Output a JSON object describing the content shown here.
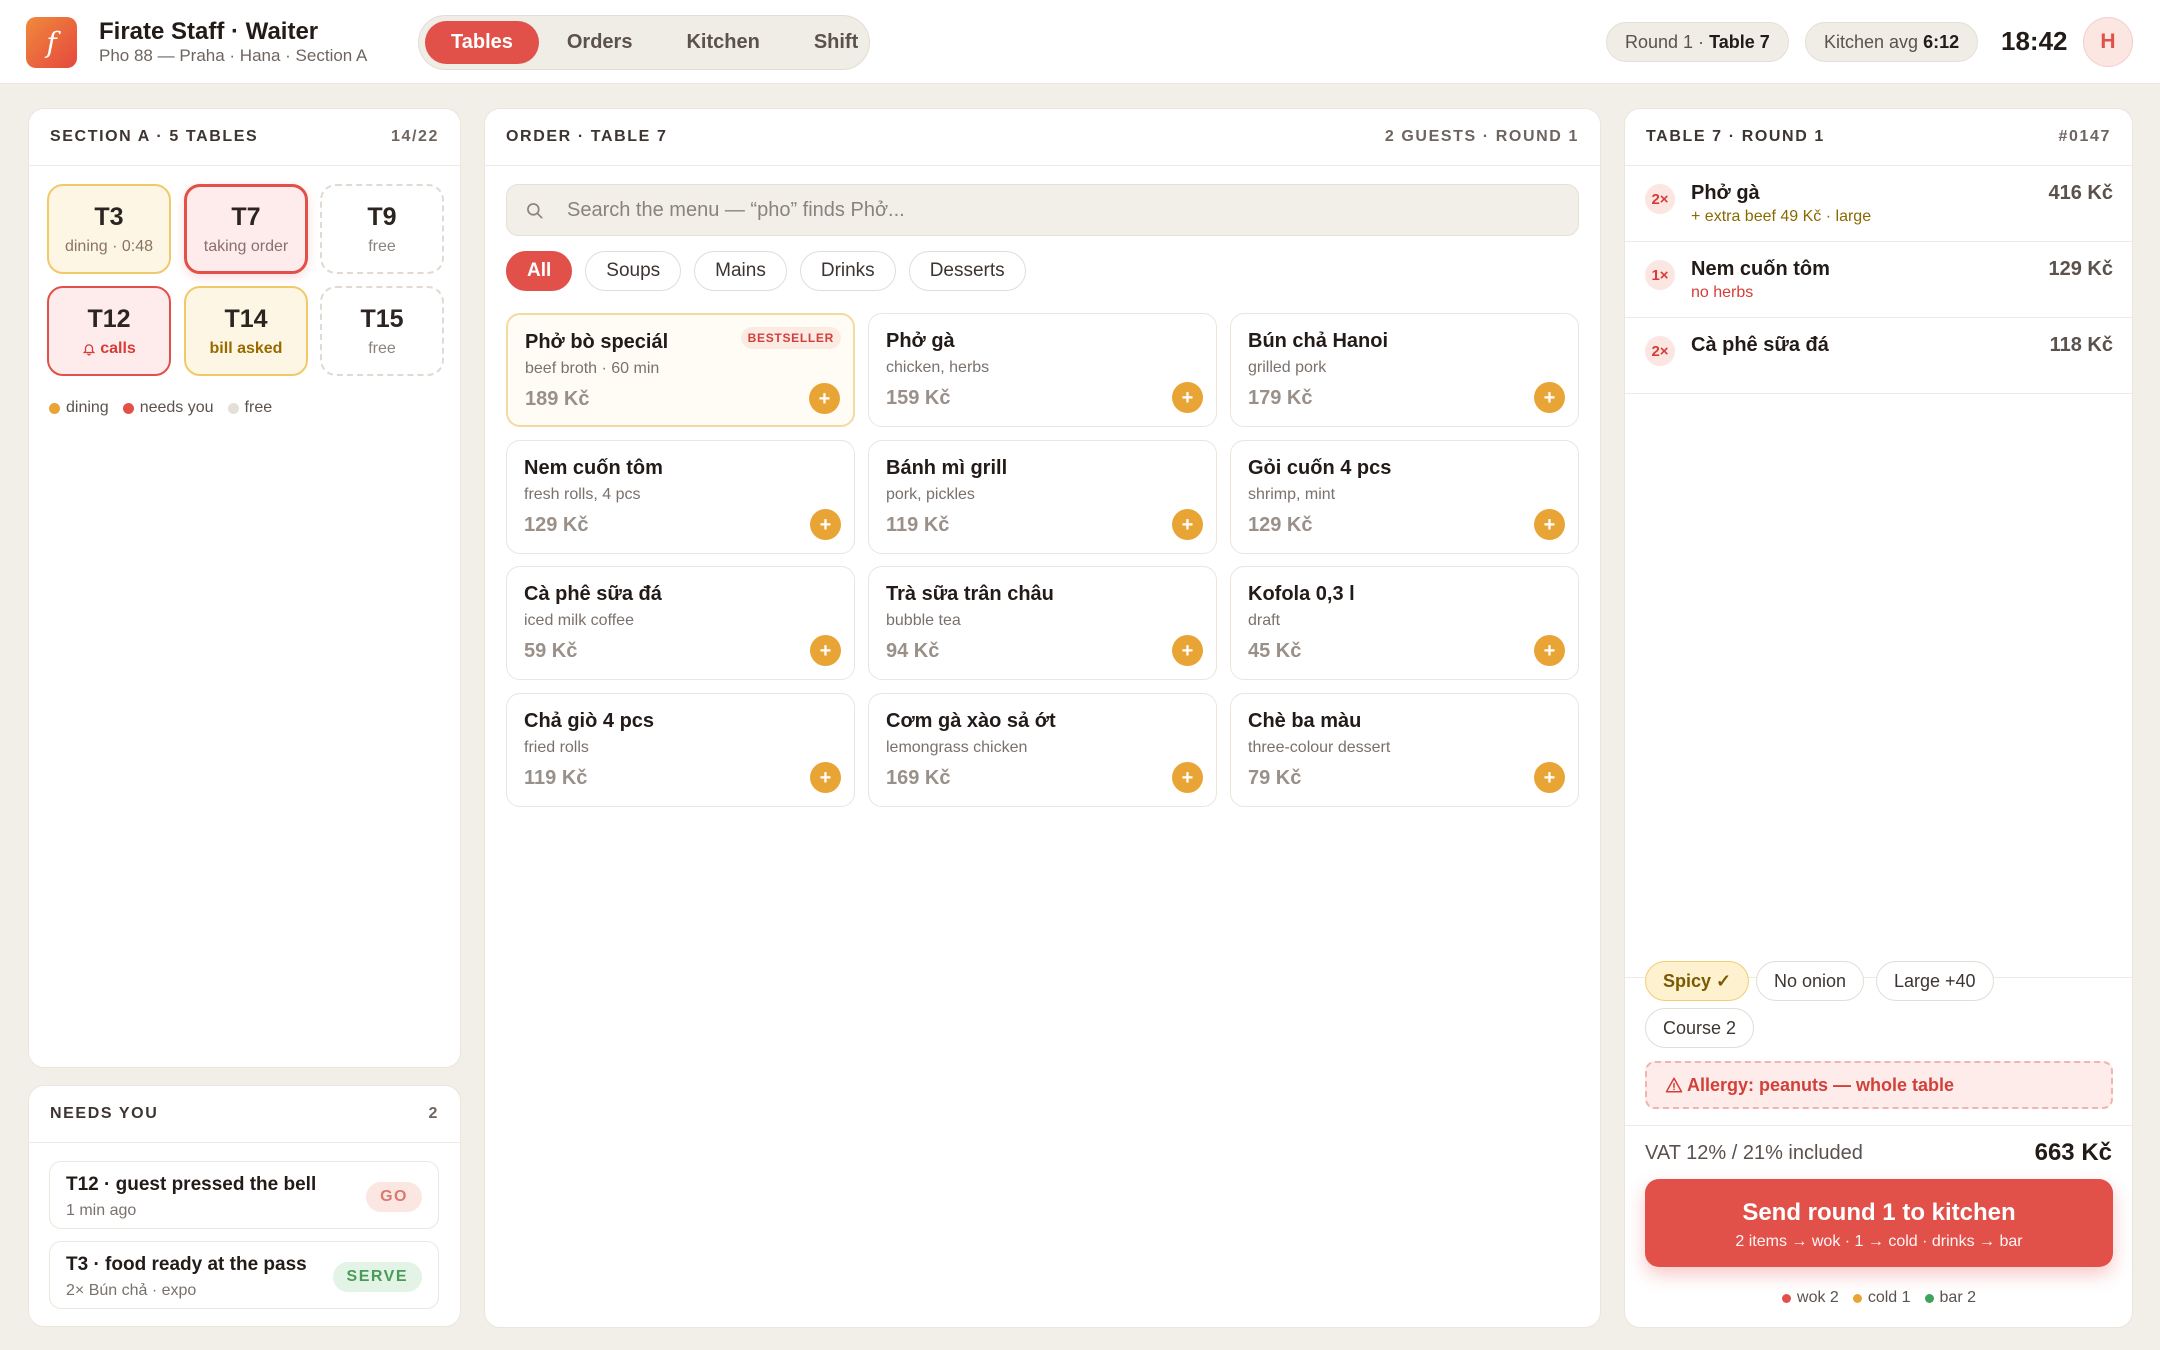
{
  "app": {
    "logo_letter": "f",
    "title": "Firate Staff · Waiter",
    "subtitle": "Pho 88 — Praha · Hana · Section A"
  },
  "nav": {
    "tabs": [
      {
        "label": "Tables",
        "active": true
      },
      {
        "label": "Orders"
      },
      {
        "label": "Kitchen"
      },
      {
        "label": "Shift"
      }
    ]
  },
  "header": {
    "round_prefix": "Round 1 ·",
    "round_table": "Table 7",
    "kitchen_prefix": "Kitchen avg",
    "kitchen_value": "6:12",
    "clock": "18:42",
    "avatar": "H"
  },
  "section": {
    "title": "SECTION A · 5 TABLES",
    "count": "14/22",
    "tables": [
      {
        "name": "T3",
        "status": "dining · 0:48",
        "state": "dining"
      },
      {
        "name": "T7",
        "status": "taking order",
        "state": "active"
      },
      {
        "name": "T9",
        "status": "free",
        "state": "free"
      },
      {
        "name": "T12",
        "status": "calls",
        "state": "calls",
        "icon": "bell-icon"
      },
      {
        "name": "T14",
        "status": "bill asked",
        "state": "bill"
      },
      {
        "name": "T15",
        "status": "free",
        "state": "free"
      }
    ],
    "legend": [
      {
        "label": "dining",
        "color": "#e8a535"
      },
      {
        "label": "needs you",
        "color": "#e2504a"
      },
      {
        "label": "free",
        "color": "#e4dfd8"
      }
    ]
  },
  "needs": {
    "title": "NEEDS YOU",
    "count": "2",
    "items": [
      {
        "title": "T12 · guest pressed the bell",
        "sub": "1 min ago",
        "action": "GO"
      },
      {
        "title": "T3 · food ready at the pass",
        "sub": "2× Bún chả · expo",
        "action": "SERVE"
      }
    ]
  },
  "order": {
    "title": "ORDER · TABLE 7",
    "meta": "2 GUESTS · ROUND 1",
    "search_placeholder": "Search the menu — “pho” finds Phở...",
    "categories": [
      "All",
      "Soups",
      "Mains",
      "Drinks",
      "Desserts"
    ],
    "menu": [
      {
        "name": "Phở bò speciál",
        "desc": "beef broth · 60 min",
        "price": "189 Kč",
        "badge": "BESTSELLER"
      },
      {
        "name": "Phở gà",
        "desc": "chicken, herbs",
        "price": "159 Kč"
      },
      {
        "name": "Bún chả Hanoi",
        "desc": "grilled pork",
        "price": "179 Kč"
      },
      {
        "name": "Nem cuốn tôm",
        "desc": "fresh rolls, 4 pcs",
        "price": "129 Kč"
      },
      {
        "name": "Bánh mì grill",
        "desc": "pork, pickles",
        "price": "119 Kč"
      },
      {
        "name": "Gỏi cuốn 4 pcs",
        "desc": "shrimp, mint",
        "price": "129 Kč"
      },
      {
        "name": "Cà phê sữa đá",
        "desc": "iced milk coffee",
        "price": "59 Kč"
      },
      {
        "name": "Trà sữa trân châu",
        "desc": "bubble tea",
        "price": "94 Kč"
      },
      {
        "name": "Kofola 0,3 l",
        "desc": "draft",
        "price": "45 Kč"
      },
      {
        "name": "Chả giò 4 pcs",
        "desc": "fried rolls",
        "price": "119 Kč"
      },
      {
        "name": "Cơm gà xào sả ớt",
        "desc": "lemongrass chicken",
        "price": "169 Kč"
      },
      {
        "name": "Chè ba màu",
        "desc": "three-colour dessert",
        "price": "79 Kč"
      }
    ],
    "add_symbol": "+"
  },
  "ticket": {
    "title": "TABLE 7 · ROUND 1",
    "number": "#0147",
    "lines": [
      {
        "qty": "2×",
        "name": "Phở gà",
        "note": "+ extra beef 49 Kč · large",
        "note_color": "#8a6a00",
        "price": "416 Kč"
      },
      {
        "qty": "1×",
        "name": "Nem cuốn tôm",
        "note": "no herbs",
        "note_color": "#d63d36",
        "price": "129 Kč"
      },
      {
        "qty": "2×",
        "name": "Cà phê sữa đá",
        "note": "",
        "price": "118 Kč"
      }
    ],
    "modifiers": [
      {
        "label": "Spicy ✓",
        "on": true
      },
      {
        "label": "No onion"
      },
      {
        "label": "Large +40"
      },
      {
        "label": "Course 2"
      }
    ],
    "allergy": "Allergy: peanuts — whole table",
    "vat": "VAT 12% / 21% included",
    "total": "663 Kč",
    "send_title": "Send round 1 to kitchen",
    "send_sub": "2 items → wok · 1 → cold · drinks → bar",
    "stations": [
      {
        "label": "wok 2",
        "color": "#e2504a"
      },
      {
        "label": "cold 1",
        "color": "#e8a535"
      },
      {
        "label": "bar 2",
        "color": "#3fa35a"
      }
    ]
  }
}
